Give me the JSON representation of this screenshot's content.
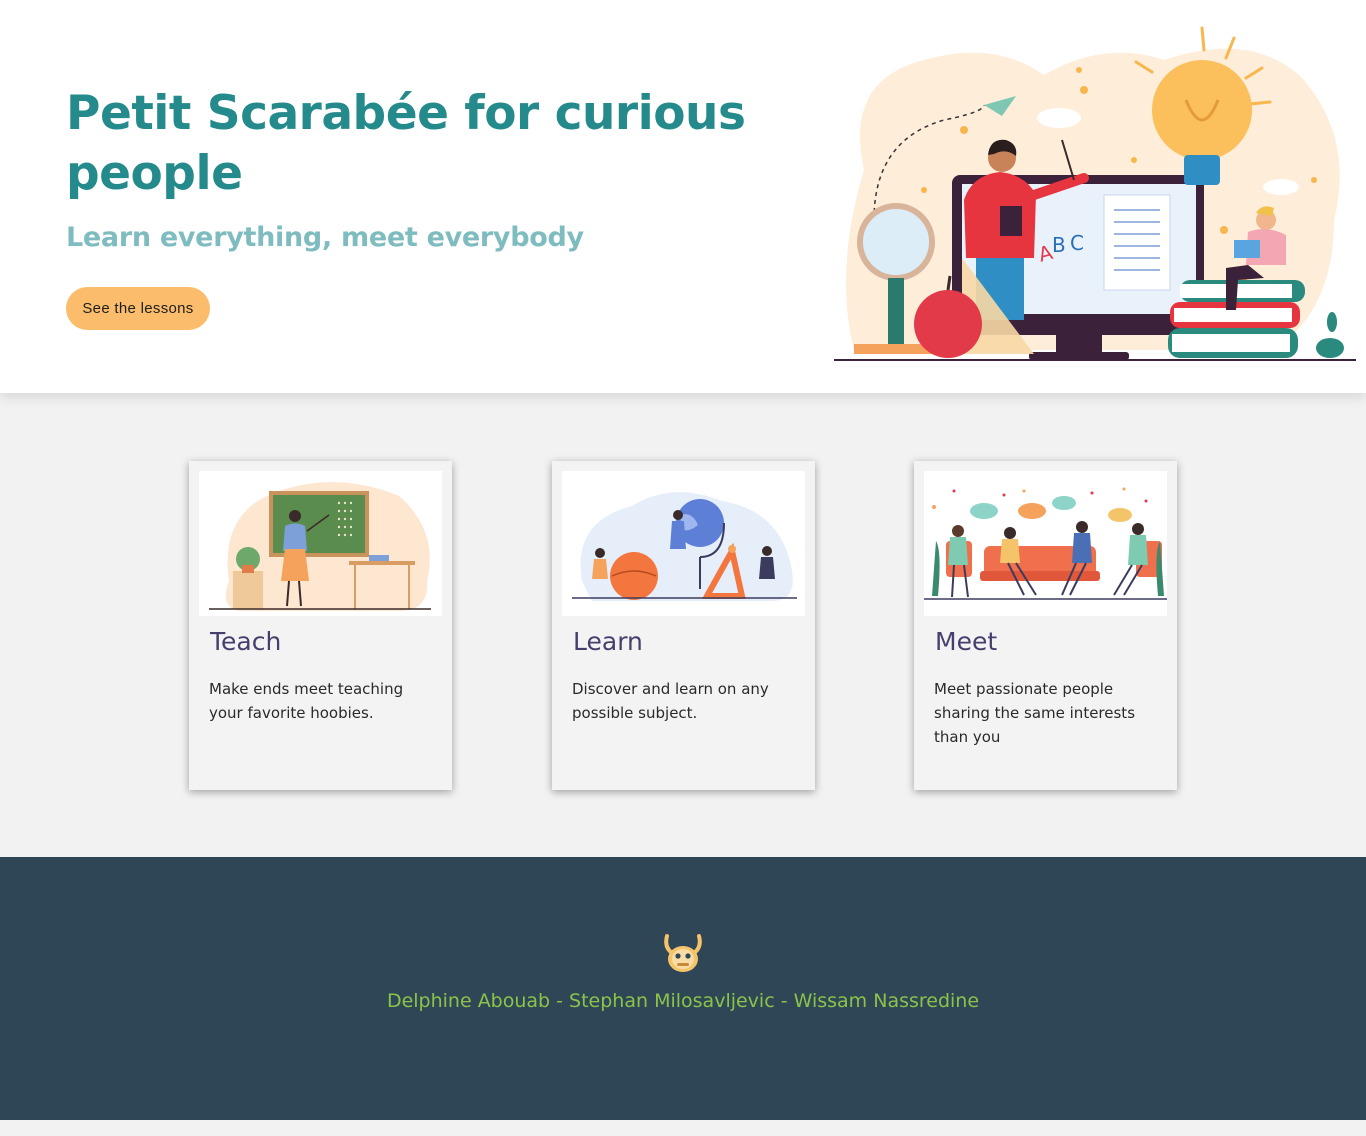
{
  "hero": {
    "title": "Petit Scarabée for curious people",
    "subtitle": "Learn everything, meet everybody",
    "cta_label": "See the lessons"
  },
  "cards": [
    {
      "title": "Teach",
      "text": "Make ends meet teaching your favorite hoobies."
    },
    {
      "title": "Learn",
      "text": "Discover and learn on any possible subject."
    },
    {
      "title": "Meet",
      "text": "Meet passionate people sharing the same interests than you"
    }
  ],
  "footer": {
    "authors": "Delphine Abouab - Stephan Milosavljevic - Wissam Nassredine"
  },
  "icons": {
    "top_logo": "scarab-logo-icon",
    "footer_logo": "scarab-logo-icon"
  },
  "colors": {
    "title": "#248a8c",
    "subtitle": "#7fbcc0",
    "cta": "#fbbd6c",
    "card_title": "#463f6e",
    "footer_bg": "#2f4656",
    "footer_text": "#8bc34a"
  }
}
